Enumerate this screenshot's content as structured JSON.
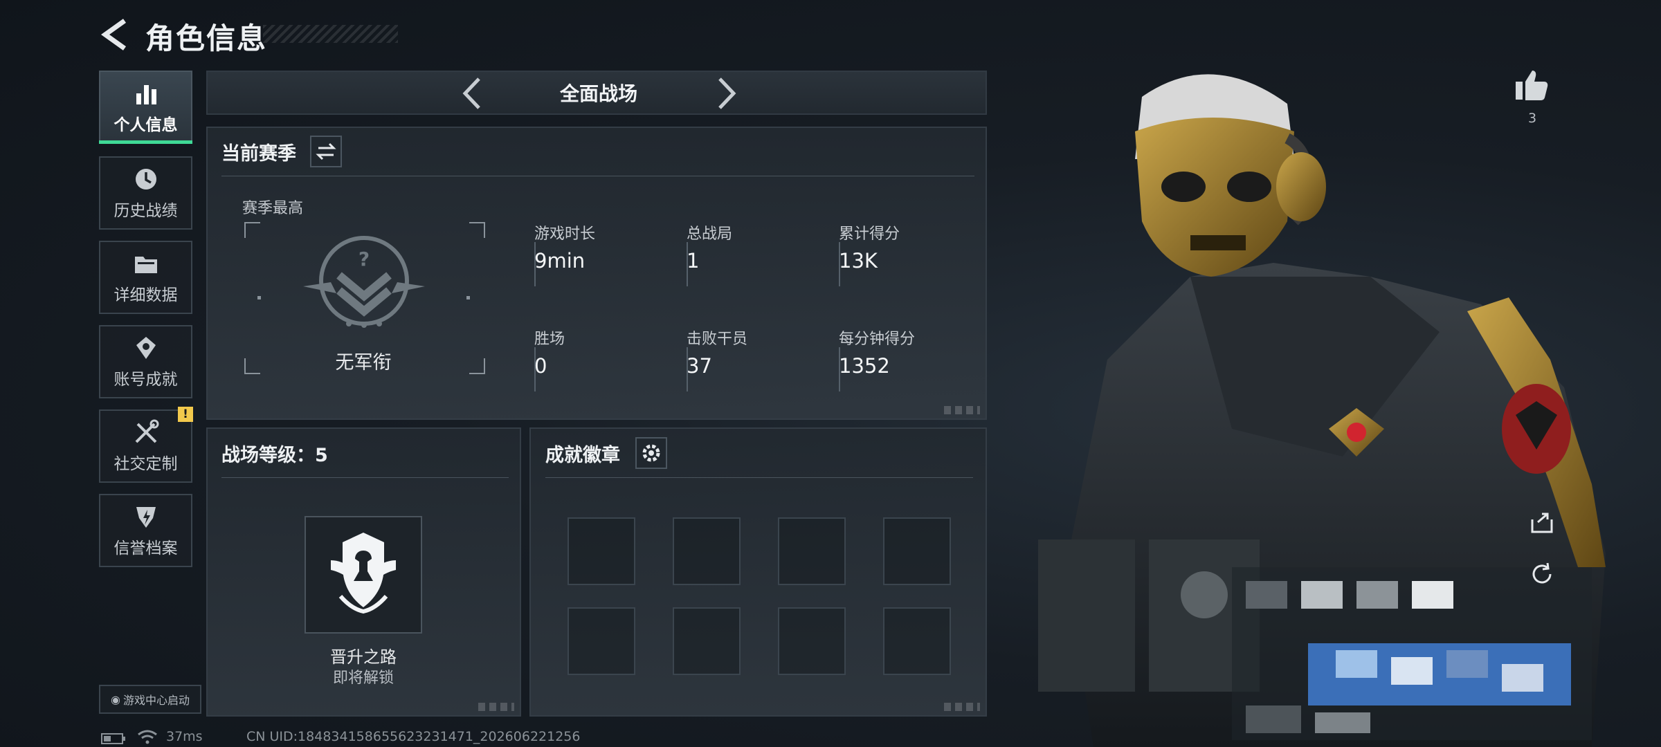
{
  "header": {
    "title": "角色信息"
  },
  "nav": {
    "items": [
      {
        "label": "个人信息",
        "icon": "bar-chart-icon",
        "active": true
      },
      {
        "label": "历史战绩",
        "icon": "clock-history-icon"
      },
      {
        "label": "详细数据",
        "icon": "folder-icon"
      },
      {
        "label": "账号成就",
        "icon": "achievement-icon"
      },
      {
        "label": "社交定制",
        "icon": "tools-icon",
        "badge": "!"
      },
      {
        "label": "信誉档案",
        "icon": "shield-bolt-icon"
      }
    ],
    "game_center": "游戏中心启动"
  },
  "mode": {
    "name": "全面战场"
  },
  "season": {
    "title": "当前赛季",
    "best_label": "赛季最高",
    "rank_name": "无军衔",
    "stats": [
      {
        "label": "游戏时长",
        "value": "9min"
      },
      {
        "label": "总战局",
        "value": "1"
      },
      {
        "label": "累计得分",
        "value": "13K"
      },
      {
        "label": "胜场",
        "value": "0"
      },
      {
        "label": "击败干员",
        "value": "37"
      },
      {
        "label": "每分钟得分",
        "value": "1352"
      }
    ]
  },
  "level": {
    "title": "战场等级：5",
    "promotion_title": "晋升之路",
    "promotion_status": "即将解锁"
  },
  "badges": {
    "title": "成就徽章"
  },
  "status_bar": {
    "ping": "37ms",
    "uid": "CN UID:1848341586556232314​71_202606221256"
  },
  "social": {
    "like_count": "3"
  },
  "colors": {
    "accent": "#3fd996",
    "warning": "#f2c94c"
  }
}
